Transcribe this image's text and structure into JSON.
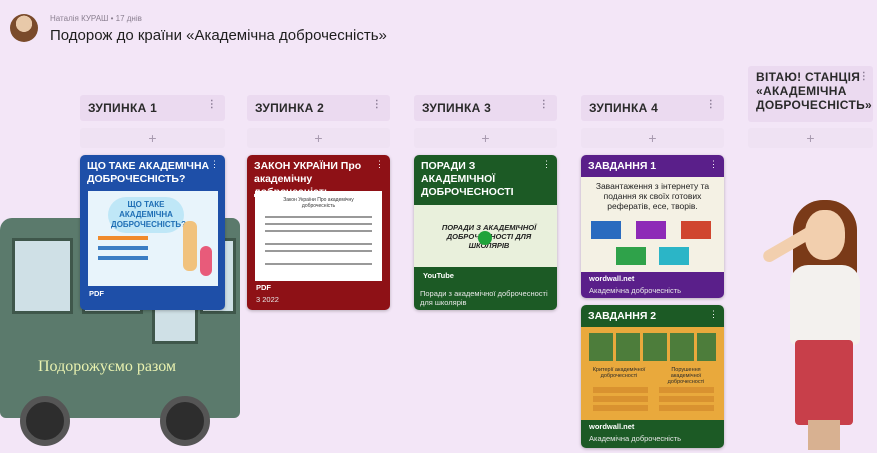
{
  "header": {
    "meta": "Наталія КУРАШ • 17 днів",
    "title": "Подорож до країни «Академічна доброчесність»"
  },
  "columns": [
    {
      "label": "ЗУПИНКА 1"
    },
    {
      "label": "ЗУПИНКА 2"
    },
    {
      "label": "ЗУПИНКА 3"
    },
    {
      "label": "ЗУПИНКА 4"
    },
    {
      "label": "ВІТАЮ! СТАНЦІЯ «АКАДЕМІЧНА ДОБРОЧЕСНІСТЬ»"
    }
  ],
  "add_label": "+",
  "dots": "⋮",
  "cards": {
    "c1": {
      "title": "ЩО ТАКЕ АКАДЕМІЧНА ДОБРОЧЕСНІСТЬ?",
      "thumb_text": "ЩО ТАКЕ АКАДЕМІЧНА ДОБРОЧЕСНІСТЬ?",
      "badge": "PDF",
      "color": "#1e4fa8"
    },
    "c2": {
      "title": "ЗАКОН УКРАЇНИ Про академічну доброчесність",
      "thumb_heading": "Закон України Про академічну доброчесність",
      "badge": "PDF",
      "caption": "3 2022",
      "color": "#8e1116"
    },
    "c3": {
      "title": "ПОРАДИ З АКАДЕМІЧНОЇ ДОБРОЧЕСНОСТІ",
      "thumb_text": "ПОРАДИ З АКАДЕМІЧНОЇ ДОБРОЧЕСНОСТІ ДЛЯ ШКОЛЯРІВ",
      "badge": "YouTube",
      "caption": "Поради з академічної доброчесності для школярів",
      "color": "#1c5a25"
    },
    "c4": {
      "title": "ЗАВДАННЯ 1",
      "thumb_text": "Завантаження з інтернету та подання як своїх готових рефератів, есе, творів.",
      "badge": "wordwall.net",
      "caption": "Академічна доброчесність",
      "color": "#5a1f8a"
    },
    "c5": {
      "title": "ЗАВДАННЯ 2",
      "thumb_left": "Критерії академічної доброчесності",
      "thumb_right": "Порушення академічної доброчесності",
      "badge": "wordwall.net",
      "caption": "Академічна доброчесність",
      "color": "#1c5a25"
    }
  },
  "bus": {
    "text": "Подорожуємо разом"
  }
}
